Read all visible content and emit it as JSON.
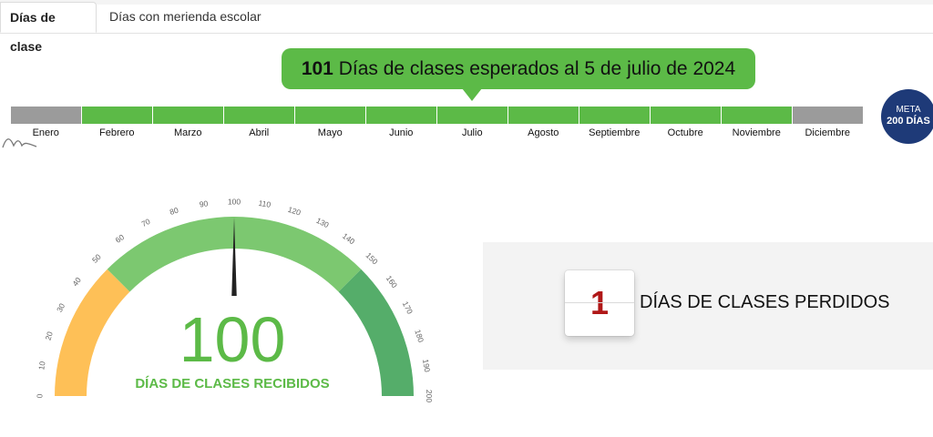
{
  "tabs": [
    {
      "label": "Días de clase",
      "active": true
    },
    {
      "label": "Días con merienda escolar",
      "active": false
    }
  ],
  "banner": {
    "number": "101",
    "text": " Días de clases esperados al 5 de julio de 2024"
  },
  "months": [
    {
      "label": "Enero",
      "status": "gray"
    },
    {
      "label": "Febrero",
      "status": "green"
    },
    {
      "label": "Marzo",
      "status": "green"
    },
    {
      "label": "Abril",
      "status": "green"
    },
    {
      "label": "Mayo",
      "status": "green"
    },
    {
      "label": "Junio",
      "status": "green"
    },
    {
      "label": "Julio",
      "status": "green"
    },
    {
      "label": "Agosto",
      "status": "green"
    },
    {
      "label": "Septiembre",
      "status": "green"
    },
    {
      "label": "Octubre",
      "status": "green"
    },
    {
      "label": "Noviembre",
      "status": "green"
    },
    {
      "label": "Diciembre",
      "status": "gray"
    }
  ],
  "goal": {
    "line1": "META",
    "line2": "200 DÍAS"
  },
  "gauge": {
    "value": 100,
    "min": 0,
    "max": 200,
    "ticks": [
      "0",
      "10",
      "20",
      "30",
      "40",
      "50",
      "60",
      "70",
      "80",
      "90",
      "100",
      "110",
      "120",
      "130",
      "140",
      "150",
      "160",
      "170",
      "180",
      "190",
      "200"
    ],
    "bands": [
      {
        "from": 0,
        "to": 50,
        "color": "#fec057"
      },
      {
        "from": 50,
        "to": 150,
        "color": "#7cc870"
      },
      {
        "from": 150,
        "to": 200,
        "color": "#55ad6a"
      }
    ],
    "number": "100",
    "caption": "DÍAS DE CLASES RECIBIDOS"
  },
  "lost": {
    "number": "1",
    "label": "DÍAS DE CLASES PERDIDOS"
  },
  "colors": {
    "green": "#5cba47",
    "gray": "#9b9b9b",
    "navy": "#1e3a78",
    "red": "#b01818"
  }
}
